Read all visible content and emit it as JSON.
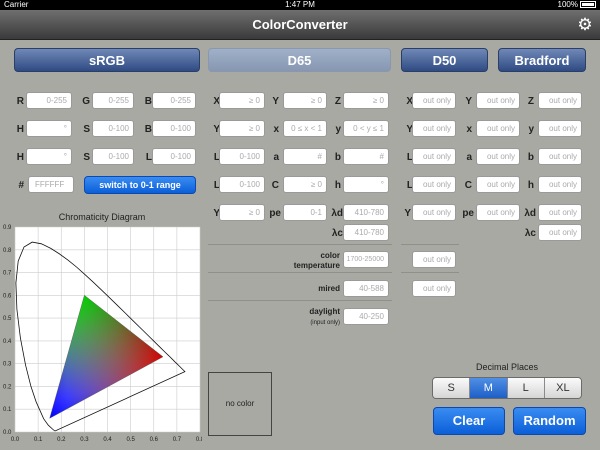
{
  "status": {
    "carrier": "Carrier",
    "time": "1:47 PM",
    "battery": "100%"
  },
  "nav": {
    "title": "ColorConverter"
  },
  "headers": {
    "srgb": "sRGB",
    "d65": "D65",
    "d50": "D50",
    "bradford": "Bradford"
  },
  "srgb": {
    "rows": [
      [
        {
          "label": "R",
          "ph": "0-255"
        },
        {
          "label": "G",
          "ph": "0-255"
        },
        {
          "label": "B",
          "ph": "0-255"
        }
      ],
      [
        {
          "label": "H",
          "ph": "°"
        },
        {
          "label": "S",
          "ph": "0-100"
        },
        {
          "label": "B",
          "ph": "0-100"
        }
      ],
      [
        {
          "label": "H",
          "ph": "°"
        },
        {
          "label": "S",
          "ph": "0-100"
        },
        {
          "label": "L",
          "ph": "0-100"
        }
      ]
    ],
    "hex_label": "#",
    "hex_ph": "FFFFFF",
    "switch_label": "switch to 0-1 range"
  },
  "d65": {
    "rows": [
      [
        {
          "label": "X",
          "ph": "≥ 0"
        },
        {
          "label": "Y",
          "ph": "≥ 0"
        },
        {
          "label": "Z",
          "ph": "≥ 0"
        }
      ],
      [
        {
          "label": "Y",
          "ph": "≥ 0"
        },
        {
          "label": "x",
          "ph": "0 ≤ x < 1"
        },
        {
          "label": "y",
          "ph": "0 < y ≤ 1"
        }
      ],
      [
        {
          "label": "L",
          "ph": "0-100"
        },
        {
          "label": "a",
          "ph": "#"
        },
        {
          "label": "b",
          "ph": "#"
        }
      ],
      [
        {
          "label": "L",
          "ph": "0-100"
        },
        {
          "label": "C",
          "ph": "≥ 0"
        },
        {
          "label": "h",
          "ph": "°"
        }
      ]
    ],
    "y_label": "Y",
    "y_ph": "≥ 0",
    "pe_label": "pe",
    "pe_ph": "0-1",
    "ld_label": "λd",
    "ld_ph": "410-780",
    "lc_label": "λc",
    "lc_ph": "410-780",
    "temp_label_1": "color",
    "temp_label_2": "temperature",
    "temp_ph": "1700-25000",
    "mired_label": "mired",
    "mired_ph": "40-588",
    "daylight_label": "daylight",
    "daylight_sub": "(input only)",
    "daylight_ph": "40-250"
  },
  "d50": {
    "ph": "out only",
    "rows": [
      [
        "X",
        "Y",
        "Z"
      ],
      [
        "Y",
        "x",
        "y"
      ],
      [
        "L",
        "a",
        "b"
      ],
      [
        "L",
        "C",
        "h"
      ]
    ],
    "y_label": "Y",
    "pe_label": "pe",
    "ld_label": "λd",
    "lc_label": "λc"
  },
  "chromaticity": {
    "title": "Chromaticity Diagram",
    "x_ticks": [
      "0.0",
      "0.1",
      "0.2",
      "0.3",
      "0.4",
      "0.5",
      "0.6",
      "0.7",
      "0.8"
    ],
    "y_ticks": [
      "0.9",
      "0.8",
      "0.7",
      "0.6",
      "0.5",
      "0.4",
      "0.3",
      "0.2",
      "0.1",
      "0.0"
    ]
  },
  "no_color": "no color",
  "decimal": {
    "title": "Decimal Places",
    "options": [
      "S",
      "M",
      "L",
      "XL"
    ],
    "selected": "M"
  },
  "buttons": {
    "clear": "Clear",
    "random": "Random"
  },
  "colors": {
    "accent": "#0b5fd8",
    "header": "#2f4b83",
    "background": "#a8a9a3"
  }
}
